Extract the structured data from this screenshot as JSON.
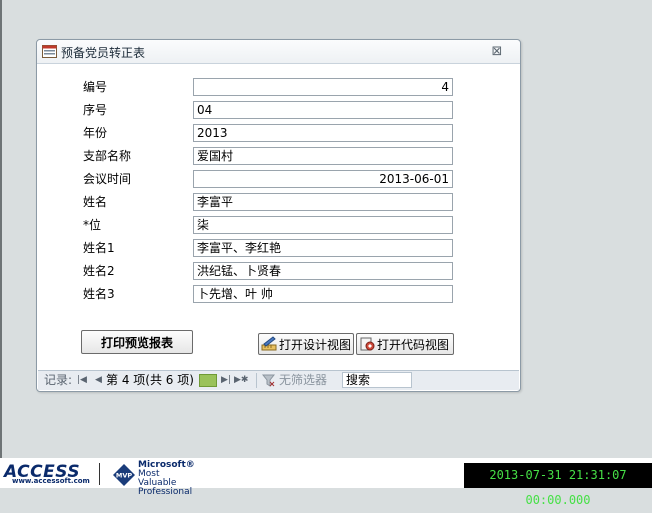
{
  "form": {
    "title": "预备党员转正表"
  },
  "fields": [
    {
      "label": "编号",
      "value": "4"
    },
    {
      "label": "序号",
      "value": "04"
    },
    {
      "label": "年份",
      "value": "2013"
    },
    {
      "label": "支部名称",
      "value": "爱国村"
    },
    {
      "label": "会议时间",
      "value": "2013-06-01"
    },
    {
      "label": "姓名",
      "value": "李富平"
    },
    {
      "label": "*位",
      "value": "柒"
    },
    {
      "label": "姓名1",
      "value": "李富平、李红艳"
    },
    {
      "label": "姓名2",
      "value": "洪纪锰、卜贤春"
    },
    {
      "label": "姓名3",
      "value": "卜先增、叶  帅"
    }
  ],
  "buttons": {
    "print_preview": "打印预览报表",
    "design_view": "打开设计视图",
    "code_view": "打开代码视图"
  },
  "navigation": {
    "record_label": "记录:",
    "position": "第 4 项(共 6 项)",
    "filter": "无筛选器",
    "search": "搜索"
  },
  "footer": {
    "access_logo": "ACCESS",
    "access_url": "www.accessoft.com",
    "mvp_badge": "MVP",
    "mvp_line1": "Microsoft®",
    "mvp_line2": "Most Valuable",
    "mvp_line3": "Professional",
    "clock": "2013-07-31 21:31:07 00:00.000"
  },
  "colors": {
    "background": "#d9dedf",
    "clock_text": "#46e046",
    "clock_bg": "#000000"
  }
}
